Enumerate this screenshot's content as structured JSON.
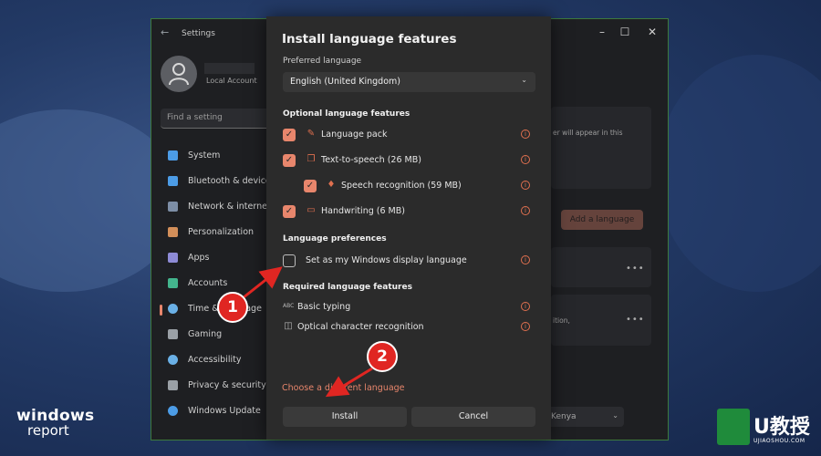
{
  "settings": {
    "app_title": "Settings",
    "account_type": "Local Account",
    "search_placeholder": "Find a setting",
    "nav_items": [
      {
        "label": "System",
        "color": "#4c9ce6"
      },
      {
        "label": "Bluetooth & devices",
        "color": "#4c9ce6"
      },
      {
        "label": "Network & internet",
        "color": "#7d8ea6"
      },
      {
        "label": "Personalization",
        "color": "#d38f5a"
      },
      {
        "label": "Apps",
        "color": "#8e8bd6"
      },
      {
        "label": "Accounts",
        "color": "#43b58d"
      },
      {
        "label": "Time & language",
        "color": "#6ab0e6"
      },
      {
        "label": "Gaming",
        "color": "#9aa0a6"
      },
      {
        "label": "Accessibility",
        "color": "#6ab0e6"
      },
      {
        "label": "Privacy & security",
        "color": "#9aa0a6"
      },
      {
        "label": "Windows Update",
        "color": "#4c9ce6"
      }
    ],
    "right_title": "n",
    "right_text_1": "er will appear in this",
    "right_text_2": "ition,",
    "add_language_label": "Add a language",
    "region_value": "Kenya"
  },
  "dialog": {
    "title": "Install language features",
    "preferred_language_label": "Preferred language",
    "preferred_language_value": "English (United Kingdom)",
    "optional_heading": "Optional language features",
    "optional_features": [
      {
        "label": "Language pack",
        "checked": true,
        "icon": "language-pack-icon"
      },
      {
        "label": "Text-to-speech (26 MB)",
        "checked": true,
        "icon": "speech-bubble-icon"
      },
      {
        "label": "Speech recognition (59 MB)",
        "checked": true,
        "icon": "microphone-icon"
      },
      {
        "label": "Handwriting (6 MB)",
        "checked": true,
        "icon": "pen-icon"
      }
    ],
    "preferences_heading": "Language preferences",
    "display_language_label": "Set as my Windows display language",
    "display_language_checked": false,
    "required_heading": "Required language features",
    "required_features": [
      {
        "label": "Basic typing",
        "icon": "abc-icon"
      },
      {
        "label": "Optical character recognition",
        "icon": "ocr-icon"
      }
    ],
    "choose_link": "Choose a different language",
    "install_label": "Install",
    "cancel_label": "Cancel"
  },
  "annotations": {
    "step1": "1",
    "step2": "2"
  },
  "watermarks": {
    "left_line1": "windows",
    "left_line2": "report",
    "right_main": "U教授",
    "right_sub": "UJIAOSHOU.COM"
  },
  "colors": {
    "accent": "#e8866c",
    "badge": "#e02622",
    "dialog_bg": "#2b2b2b"
  }
}
